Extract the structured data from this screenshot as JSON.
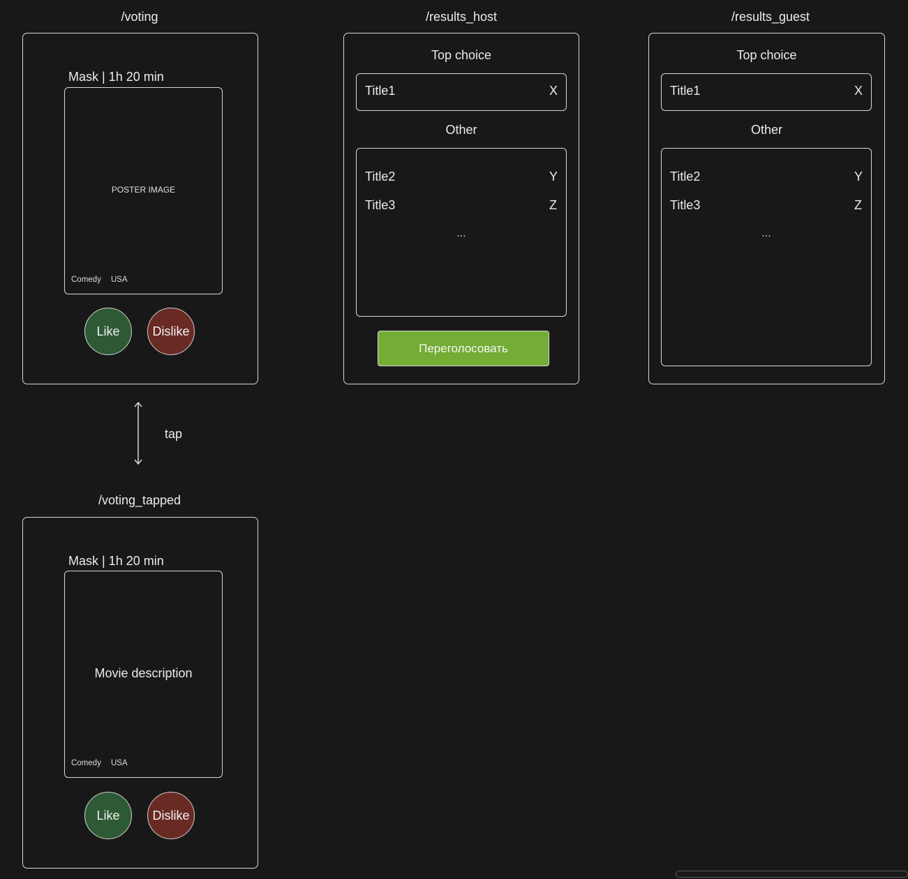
{
  "screens": {
    "voting": {
      "route": "/voting",
      "movie_title": "Mask | 1h 20 min",
      "poster_text": "POSTER IMAGE",
      "genre": "Comedy",
      "country": "USA",
      "like_label": "Like",
      "dislike_label": "Dislike"
    },
    "voting_tapped": {
      "route": "/voting_tapped",
      "movie_title": "Mask | 1h 20 min",
      "description_text": "Movie description",
      "genre": "Comedy",
      "country": "USA",
      "like_label": "Like",
      "dislike_label": "Dislike"
    },
    "results_host": {
      "route": "/results_host",
      "top_choice_label": "Top choice",
      "top_choice": {
        "title": "Title1",
        "value": "X"
      },
      "other_label": "Other",
      "others": [
        {
          "title": "Title2",
          "value": "Y"
        },
        {
          "title": "Title3",
          "value": "Z"
        }
      ],
      "more": "...",
      "revote_label": "Переголосовать"
    },
    "results_guest": {
      "route": "/results_guest",
      "top_choice_label": "Top choice",
      "top_choice": {
        "title": "Title1",
        "value": "X"
      },
      "other_label": "Other",
      "others": [
        {
          "title": "Title2",
          "value": "Y"
        },
        {
          "title": "Title3",
          "value": "Z"
        }
      ],
      "more": "..."
    }
  },
  "transition": {
    "label": "tap"
  },
  "colors": {
    "background": "#181818",
    "like": "#2d5a34",
    "dislike": "#6a2a24",
    "revote": "#74ad35"
  }
}
